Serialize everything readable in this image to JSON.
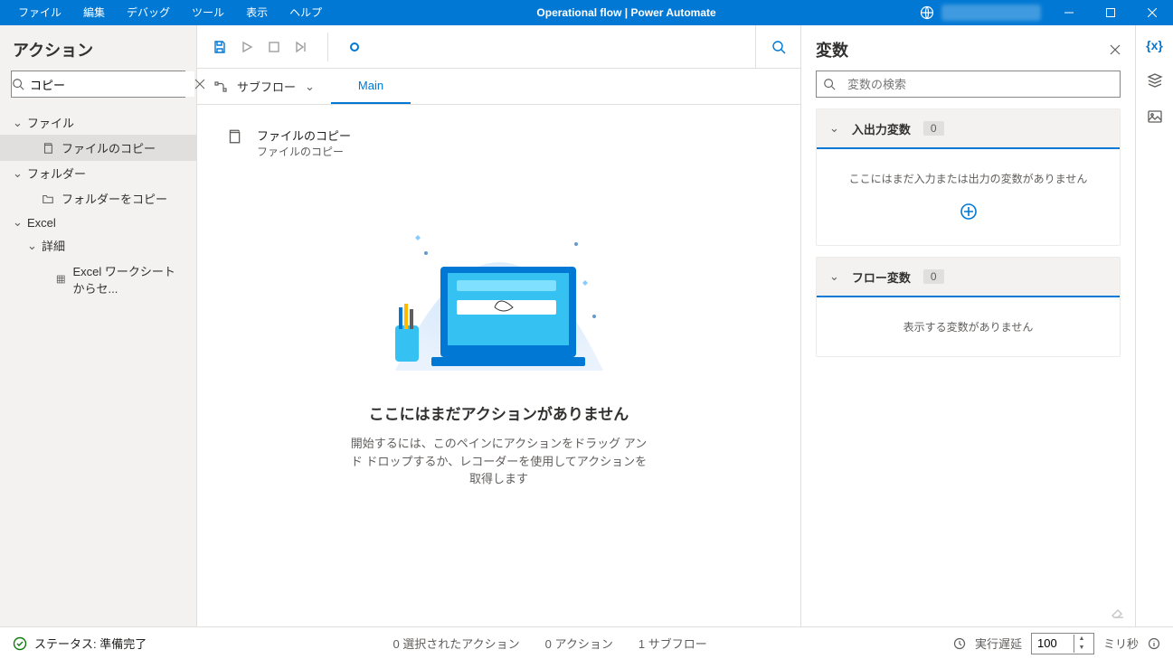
{
  "menu": {
    "file": "ファイル",
    "edit": "編集",
    "debug": "デバッグ",
    "tools": "ツール",
    "view": "表示",
    "help": "ヘルプ"
  },
  "title": "Operational flow | Power Automate",
  "left": {
    "title": "アクション",
    "search_value": "コピー",
    "groups": {
      "file": "ファイル",
      "file_copy": "ファイルのコピー",
      "folder": "フォルダー",
      "folder_copy": "フォルダーをコピー",
      "excel": "Excel",
      "detail": "詳細",
      "excel_cells": "Excel ワークシートからセ..."
    }
  },
  "subflow": {
    "label": "サブフロー",
    "tab_main": "Main"
  },
  "canvas": {
    "card_title": "ファイルのコピー",
    "card_sub": "ファイルのコピー",
    "empty_title": "ここにはまだアクションがありません",
    "empty_sub": "開始するには、このペインにアクションをドラッグ アンド ドロップするか、レコーダーを使用してアクションを取得します"
  },
  "right": {
    "title": "変数",
    "search_placeholder": "変数の検索",
    "io_title": "入出力変数",
    "io_count": "0",
    "io_empty": "ここにはまだ入力または出力の変数がありません",
    "flow_title": "フロー変数",
    "flow_count": "0",
    "flow_empty": "表示する変数がありません"
  },
  "status": {
    "ready": "ステータス: 準備完了",
    "selected": "0 選択されたアクション",
    "actions": "0 アクション",
    "subflows": "1 サブフロー",
    "delay": "実行遅延",
    "delay_value": "100",
    "ms": "ミリ秒"
  }
}
